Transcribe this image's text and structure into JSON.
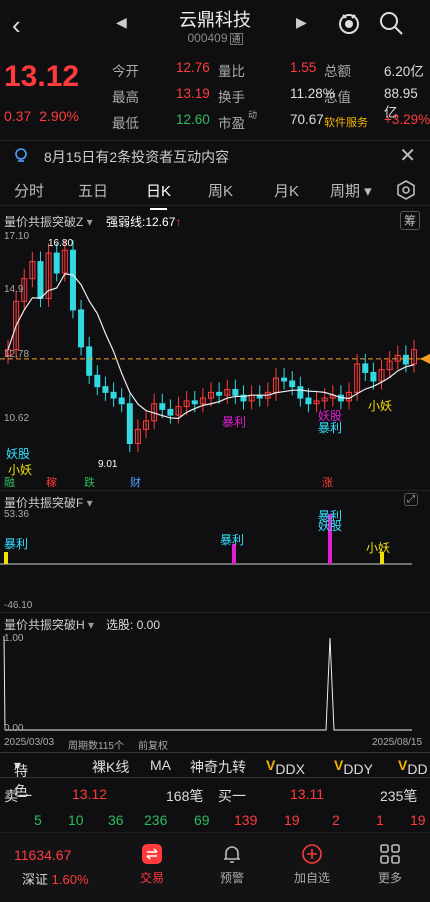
{
  "header": {
    "title": "云鼎科技",
    "code": "000409",
    "code_tag": "通",
    "back_icon": "chevron-left-icon",
    "prev_icon": "triangle-left-icon",
    "next_icon": "triangle-right-icon"
  },
  "quote": {
    "price": "13.12",
    "change": "0.37",
    "change_pct": "2.90%",
    "rows": [
      {
        "l1": "今开",
        "v1": "12.76",
        "l2": "量比",
        "v2": "1.55",
        "l3": "总额",
        "v3": "6.20亿"
      },
      {
        "l1": "最高",
        "v1": "13.19",
        "l2": "换手",
        "v2": "11.28%",
        "l3": "总值",
        "v3": "88.95亿"
      },
      {
        "l1": "最低",
        "v1": "12.60",
        "l2": "市盈",
        "v2": "70.67",
        "l3": "软件服务",
        "v3": "+3.29%"
      }
    ],
    "pe_mark": "动"
  },
  "notice": {
    "text": "8月15日有2条投资者互动内容"
  },
  "tabs": [
    "分时",
    "五日",
    "日K",
    "周K",
    "月K",
    "周期"
  ],
  "active_tab": "日K",
  "indicator_main": {
    "name": "量价共振突破Z",
    "strength": "强弱线:12.67",
    "fu": "筹",
    "y_top": "17.10",
    "y_mid1": "14.9",
    "y_line": "12.78",
    "y_low": "10.62",
    "high_label": "16.80",
    "low_label": "9.01",
    "signals": [
      "妖股",
      "小妖",
      "暴利",
      "妖股",
      "暴利",
      "小妖"
    ],
    "bottom_tags": [
      "融",
      "稼",
      "跌",
      "财",
      "涨"
    ]
  },
  "chart_data": {
    "type": "candlestick",
    "title": "",
    "closes": [
      13.1,
      14.8,
      15.6,
      16.2,
      14.9,
      16.5,
      15.8,
      16.6,
      14.5,
      13.2,
      12.2,
      11.8,
      11.6,
      11.4,
      11.2,
      9.8,
      10.3,
      10.6,
      11.2,
      11.0,
      10.8,
      11.1,
      11.3,
      11.2,
      11.4,
      11.6,
      11.5,
      11.7,
      11.5,
      11.3,
      11.5,
      11.4,
      11.6,
      12.1,
      12.0,
      11.8,
      11.4,
      11.2,
      11.3,
      11.4,
      11.5,
      11.3,
      11.6,
      12.6,
      12.3,
      12.0,
      12.4,
      12.7,
      12.9,
      12.6,
      13.1
    ],
    "ylim": [
      9.01,
      17.1
    ],
    "reference_line": 12.78,
    "strength_line": 12.67,
    "high": 16.8,
    "low": 9.01
  },
  "indicator_f": {
    "name": "量价共振突破F",
    "y_top": "53.36",
    "y_bottom": "-46.10",
    "signals": [
      "暴利",
      "暴利",
      "妖股",
      "暴利",
      "小妖"
    ]
  },
  "indicator_h": {
    "name": "量价共振突破H",
    "pick": "选股: 0.00",
    "y_top": "1.00",
    "y_bottom": "0.00",
    "x_start": "2025/03/03",
    "period_count": "周期数115个",
    "adjust": "前复权",
    "x_end": "2025/08/15"
  },
  "toolbar": [
    "特色",
    "裸K线",
    "MA",
    "神奇九转",
    "DDX",
    "DDY",
    "DD"
  ],
  "orderbook": {
    "sell_label": "卖一",
    "sell_price": "13.12",
    "sell_vol": "168笔",
    "buy_label": "买一",
    "buy_price": "13.11",
    "buy_vol": "235笔",
    "sell_queue": [
      "5",
      "10",
      "36",
      "236",
      "69"
    ],
    "buy_queue": [
      "139",
      "19",
      "2",
      "1",
      "19"
    ]
  },
  "nav": {
    "index_value": "11634.67",
    "index_name": "深证",
    "index_pct": "1.60%",
    "items": [
      "交易",
      "预警",
      "加自选",
      "更多"
    ]
  },
  "colors": {
    "up": "#ff3b3b",
    "down": "#2dbb5c",
    "accent_yellow": "#f0b400",
    "magenta": "#e020d0",
    "cyan": "#33e0ff"
  }
}
